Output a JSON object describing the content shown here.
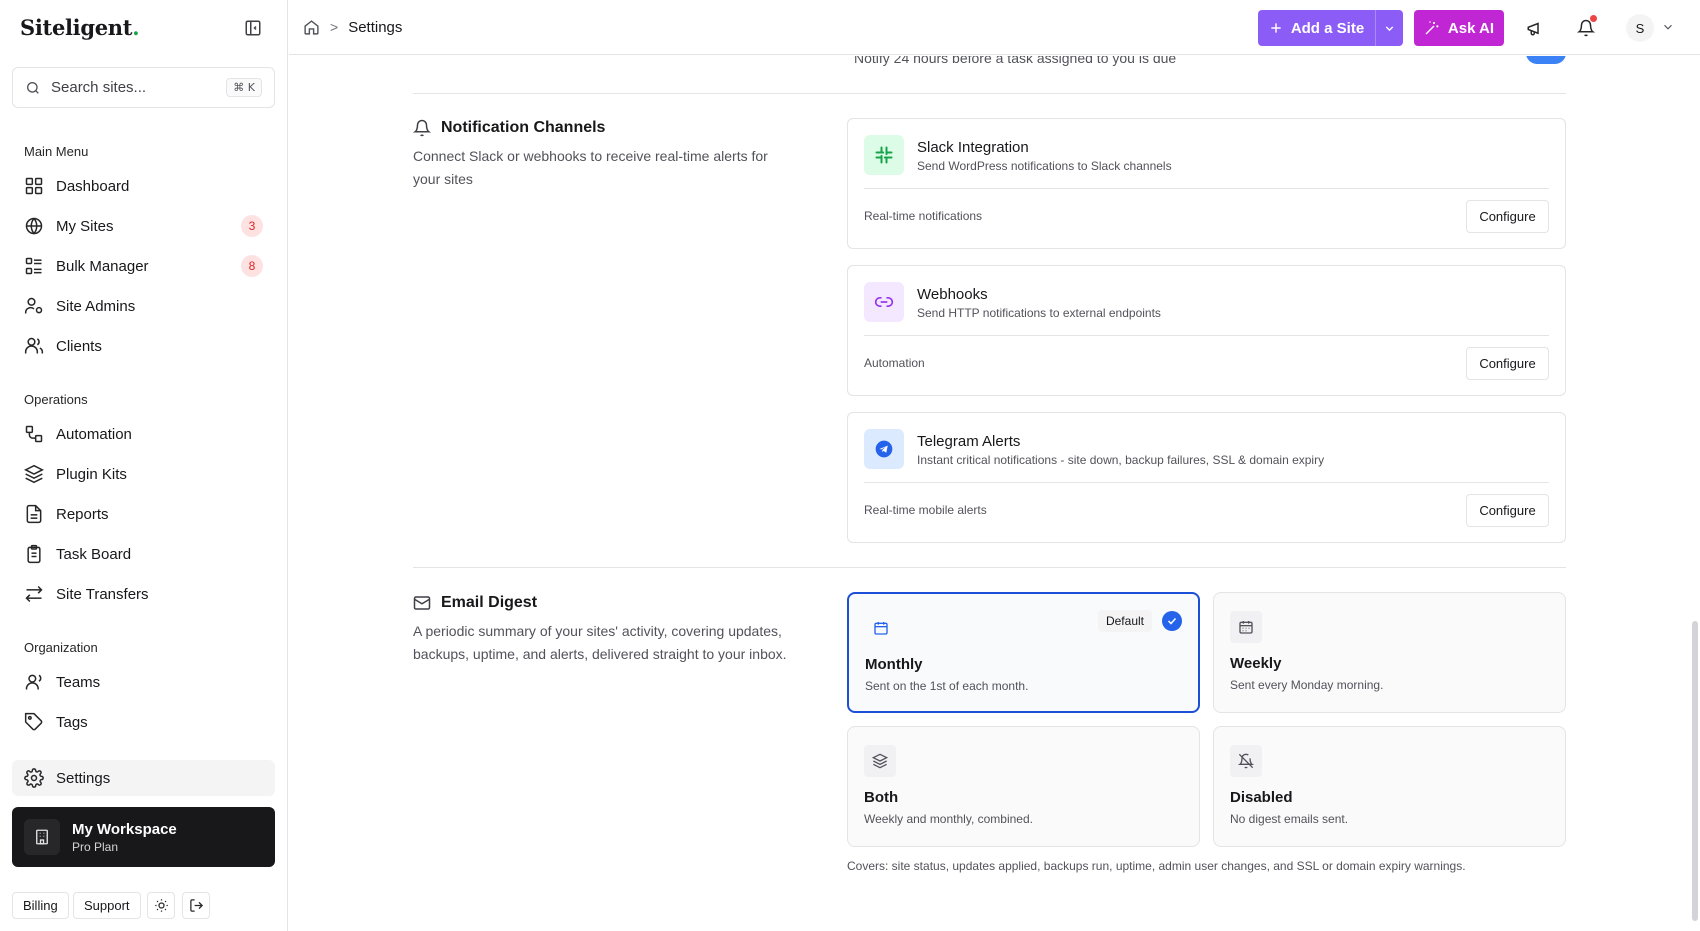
{
  "sidebar": {
    "logo": "Siteligent",
    "logo_dot": ".",
    "search_placeholder": "Search sites...",
    "search_shortcut": "⌘ K",
    "main_menu_label": "Main Menu",
    "main_menu": [
      {
        "label": "Dashboard",
        "icon": "grid-icon"
      },
      {
        "label": "My Sites",
        "icon": "globe-icon",
        "badge": "3"
      },
      {
        "label": "Bulk Manager",
        "icon": "list-icon",
        "badge": "8"
      },
      {
        "label": "Site Admins",
        "icon": "user-cog-icon"
      },
      {
        "label": "Clients",
        "icon": "users-icon"
      }
    ],
    "operations_label": "Operations",
    "operations": [
      {
        "label": "Automation",
        "icon": "workflow-icon"
      },
      {
        "label": "Plugin Kits",
        "icon": "layers-icon"
      },
      {
        "label": "Reports",
        "icon": "file-icon"
      },
      {
        "label": "Task Board",
        "icon": "clipboard-icon"
      },
      {
        "label": "Site Transfers",
        "icon": "arrows-icon"
      }
    ],
    "organization_label": "Organization",
    "organization": [
      {
        "label": "Teams",
        "icon": "team-icon"
      },
      {
        "label": "Tags",
        "icon": "tag-icon"
      }
    ],
    "settings_label": "Settings",
    "workspace": {
      "title": "My Workspace",
      "plan": "Pro Plan"
    },
    "footer": {
      "billing": "Billing",
      "support": "Support"
    }
  },
  "topbar": {
    "breadcrumb_current": "Settings",
    "breadcrumb_sep": ">",
    "add_site": "Add a Site",
    "ask_ai": "Ask AI",
    "avatar_initial": "S"
  },
  "main": {
    "partial_text": "Notify 24 hours before a task assigned to you is due",
    "channels_section": {
      "title": "Notification Channels",
      "description": "Connect Slack or webhooks to receive real-time alerts for your sites"
    },
    "channels": [
      {
        "title": "Slack Integration",
        "subtitle": "Send WordPress notifications to Slack channels",
        "footer": "Real-time notifications",
        "action": "Configure",
        "icon": "slack-icon",
        "color": "#16a34a",
        "bg": "#dcfce7"
      },
      {
        "title": "Webhooks",
        "subtitle": "Send HTTP notifications to external endpoints",
        "footer": "Automation",
        "action": "Configure",
        "icon": "link-icon",
        "color": "#9333ea",
        "bg": "#f3e8ff"
      },
      {
        "title": "Telegram Alerts",
        "subtitle": "Instant critical notifications - site down, backup failures, SSL & domain expiry",
        "footer": "Real-time mobile alerts",
        "action": "Configure",
        "icon": "telegram-icon",
        "color": "#2563eb",
        "bg": "#dbeafe"
      }
    ],
    "digest_section": {
      "title": "Email Digest",
      "description": "A periodic summary of your sites' activity, covering updates, backups, uptime, and alerts, delivered straight to your inbox."
    },
    "digest_options": [
      {
        "title": "Monthly",
        "subtitle": "Sent on the 1st of each month.",
        "selected": true,
        "pill": "Default",
        "icon": "calendar-icon"
      },
      {
        "title": "Weekly",
        "subtitle": "Sent every Monday morning.",
        "selected": false,
        "icon": "calendar-grid-icon"
      },
      {
        "title": "Both",
        "subtitle": "Weekly and monthly, combined.",
        "selected": false,
        "icon": "layers-icon"
      },
      {
        "title": "Disabled",
        "subtitle": "No digest emails sent.",
        "selected": false,
        "icon": "bell-off-icon"
      }
    ],
    "covers_text": "Covers: site status, updates applied, backups run, uptime, admin user changes, and SSL or domain expiry warnings."
  },
  "colors": {
    "accent_blue": "#2563eb",
    "add_site_purple": "#8b5cf6",
    "ask_ai_magenta": "#c026d3",
    "badge_red": "#dc2626"
  }
}
